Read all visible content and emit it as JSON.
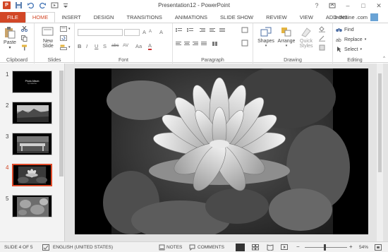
{
  "window": {
    "title": "Presentation12 - PowerPoint",
    "help": "?",
    "minimize": "–",
    "restore": "□",
    "close": "✕"
  },
  "tabs": [
    "FILE",
    "HOME",
    "INSERT",
    "DESIGN",
    "TRANSITIONS",
    "ANIMATIONS",
    "SLIDE SHOW",
    "REVIEW",
    "VIEW",
    "ADD-INS"
  ],
  "active_tab": "HOME",
  "user": {
    "name": "Indezine .com"
  },
  "ribbon": {
    "clipboard": {
      "label": "Clipboard",
      "paste": "Paste"
    },
    "slides": {
      "label": "Slides",
      "new_slide_1": "New",
      "new_slide_2": "Slide"
    },
    "font": {
      "label": "Font",
      "bold": "B",
      "italic": "I",
      "underline": "U",
      "shadow": "S",
      "strike": "abc",
      "spacing": "AV",
      "case": "Aa",
      "color": "A",
      "grow": "A",
      "shrink": "A",
      "clear": "A"
    },
    "paragraph": {
      "label": "Paragraph"
    },
    "drawing": {
      "label": "Drawing",
      "shapes": "Shapes",
      "arrange": "Arrange",
      "quick_1": "Quick",
      "quick_2": "Styles"
    },
    "editing": {
      "label": "Editing",
      "find": "Find",
      "replace": "Replace",
      "select": "Select"
    }
  },
  "slides": [
    {
      "num": "1",
      "title": "Photo Album",
      "sub": "by Indezine"
    },
    {
      "num": "2"
    },
    {
      "num": "3"
    },
    {
      "num": "4"
    },
    {
      "num": "5"
    }
  ],
  "active_slide": 4,
  "status": {
    "slide": "SLIDE 4 OF 5",
    "language": "ENGLISH (UNITED STATES)",
    "notes": "NOTES",
    "comments": "COMMENTS",
    "zoom": "54%"
  },
  "colors": {
    "accent": "#d24726",
    "ribbon_bg": "#ffffff",
    "workspace": "#e3e3e3"
  }
}
